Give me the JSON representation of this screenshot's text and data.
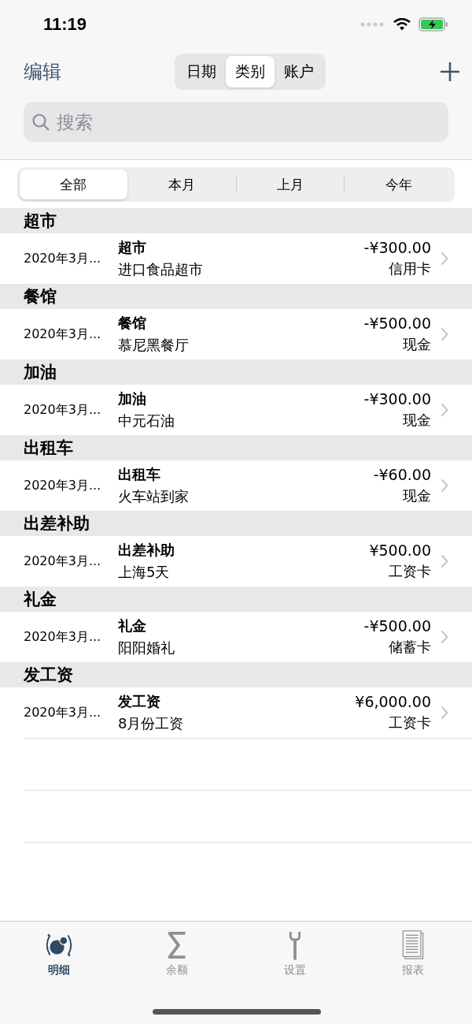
{
  "status_bar": {
    "time": "11:19"
  },
  "nav": {
    "edit": "编辑",
    "segments": [
      {
        "label": "日期",
        "selected": false
      },
      {
        "label": "类别",
        "selected": true
      },
      {
        "label": "账户",
        "selected": false
      }
    ]
  },
  "search": {
    "placeholder": "搜索"
  },
  "filter": [
    {
      "label": "全部",
      "selected": true
    },
    {
      "label": "本月",
      "selected": false
    },
    {
      "label": "上月",
      "selected": false
    },
    {
      "label": "今年",
      "selected": false
    }
  ],
  "sections": [
    {
      "title": "超市",
      "rows": [
        {
          "date": "2020年3月...",
          "category": "超市",
          "note": "进口食品超市",
          "amount": "-¥300.00",
          "account": "信用卡"
        }
      ]
    },
    {
      "title": "餐馆",
      "rows": [
        {
          "date": "2020年3月...",
          "category": "餐馆",
          "note": "慕尼黑餐厅",
          "amount": "-¥500.00",
          "account": "现金"
        }
      ]
    },
    {
      "title": "加油",
      "rows": [
        {
          "date": "2020年3月...",
          "category": "加油",
          "note": "中元石油",
          "amount": "-¥300.00",
          "account": "现金"
        }
      ]
    },
    {
      "title": "出租车",
      "rows": [
        {
          "date": "2020年3月...",
          "category": "出租车",
          "note": "火车站到家",
          "amount": "-¥60.00",
          "account": "现金"
        }
      ]
    },
    {
      "title": "出差补助",
      "rows": [
        {
          "date": "2020年3月...",
          "category": "出差补助",
          "note": "上海5天",
          "amount": "¥500.00",
          "account": "工资卡"
        }
      ]
    },
    {
      "title": "礼金",
      "rows": [
        {
          "date": "2020年3月...",
          "category": "礼金",
          "note": "阳阳婚礼",
          "amount": "-¥500.00",
          "account": "储蓄卡"
        }
      ]
    },
    {
      "title": "发工资",
      "rows": [
        {
          "date": "2020年3月...",
          "category": "发工资",
          "note": "8月份工资",
          "amount": "¥6,000.00",
          "account": "工资卡"
        }
      ]
    }
  ],
  "tab_bar": [
    {
      "kind": "coins",
      "label": "明细",
      "selected": true
    },
    {
      "kind": "sigma",
      "label": "余额",
      "selected": false
    },
    {
      "kind": "wrench",
      "label": "设置",
      "selected": false
    },
    {
      "kind": "report",
      "label": "报表",
      "selected": false
    }
  ]
}
